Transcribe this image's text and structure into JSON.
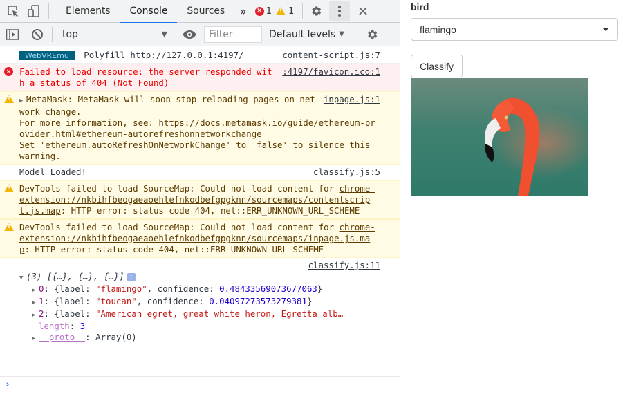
{
  "devtools": {
    "tabs": [
      {
        "label": "Elements",
        "active": false
      },
      {
        "label": "Console",
        "active": true
      },
      {
        "label": "Sources",
        "active": false
      }
    ],
    "more_tabs_glyph": "»",
    "error_count": "1",
    "warning_count": "1",
    "toolbar": {
      "context": "top",
      "filter_placeholder": "Filter",
      "levels": "Default levels"
    },
    "messages": {
      "m0": {
        "badge": "WebVREmu",
        "text": "Polyfill",
        "url": "http://127.0.0.1:4197/",
        "source": "content-script.js:7"
      },
      "m1": {
        "text": "Failed to load resource: the server responded with a status of 404 (Not Found)",
        "source": ":4197/favicon.ico:1"
      },
      "m2": {
        "line1": "MetaMask: MetaMask will soon stop reloading pages on network change.",
        "line2_prefix": "For more information, see: ",
        "line2_url": "https://docs.metamask.io/guide/ethereum-provider.html#ethereum-autorefreshonnetworkchange",
        "line3": "Set 'ethereum.autoRefreshOnNetworkChange' to 'false' to silence this warning.",
        "source": "inpage.js:1"
      },
      "m3": {
        "text": "Model Loaded!",
        "source": "classify.js:5"
      },
      "m4": {
        "prefix": "DevTools failed to load SourceMap: Could not load content for ",
        "url": "chrome-extension://nkbihfbeogaeaoehlefnkodbefgpgknn/sourcemaps/contentscript.js.map",
        "suffix": ": HTTP error: status code 404, net::ERR_UNKNOWN_URL_SCHEME"
      },
      "m5": {
        "prefix": "DevTools failed to load SourceMap: Could not load content for ",
        "url": "chrome-extension://nkbihfbeogaeaoehlefnkodbefgpgknn/sourcemaps/inpage.js.map",
        "suffix": ": HTTP error: status code 404, net::ERR_UNKNOWN_URL_SCHEME"
      },
      "m6": {
        "source": "classify.js:11",
        "summary": "(3) [{…}, {…}, {…}]",
        "items": [
          {
            "index": "0",
            "label": "\"flamingo\"",
            "confidence": "0.48433569073677063"
          },
          {
            "index": "1",
            "label": "\"toucan\"",
            "confidence": "0.04097273573279381"
          },
          {
            "index": "2",
            "label": "\"American egret, great white heron, Egretta alb…"
          }
        ],
        "length_key": "length",
        "length_val": "3",
        "proto_key": "__proto__",
        "proto_val": "Array(0)"
      }
    },
    "prompt_glyph": "›"
  },
  "page": {
    "select_label": "bird",
    "select_value": "flamingo",
    "classify_button": "Classify"
  }
}
